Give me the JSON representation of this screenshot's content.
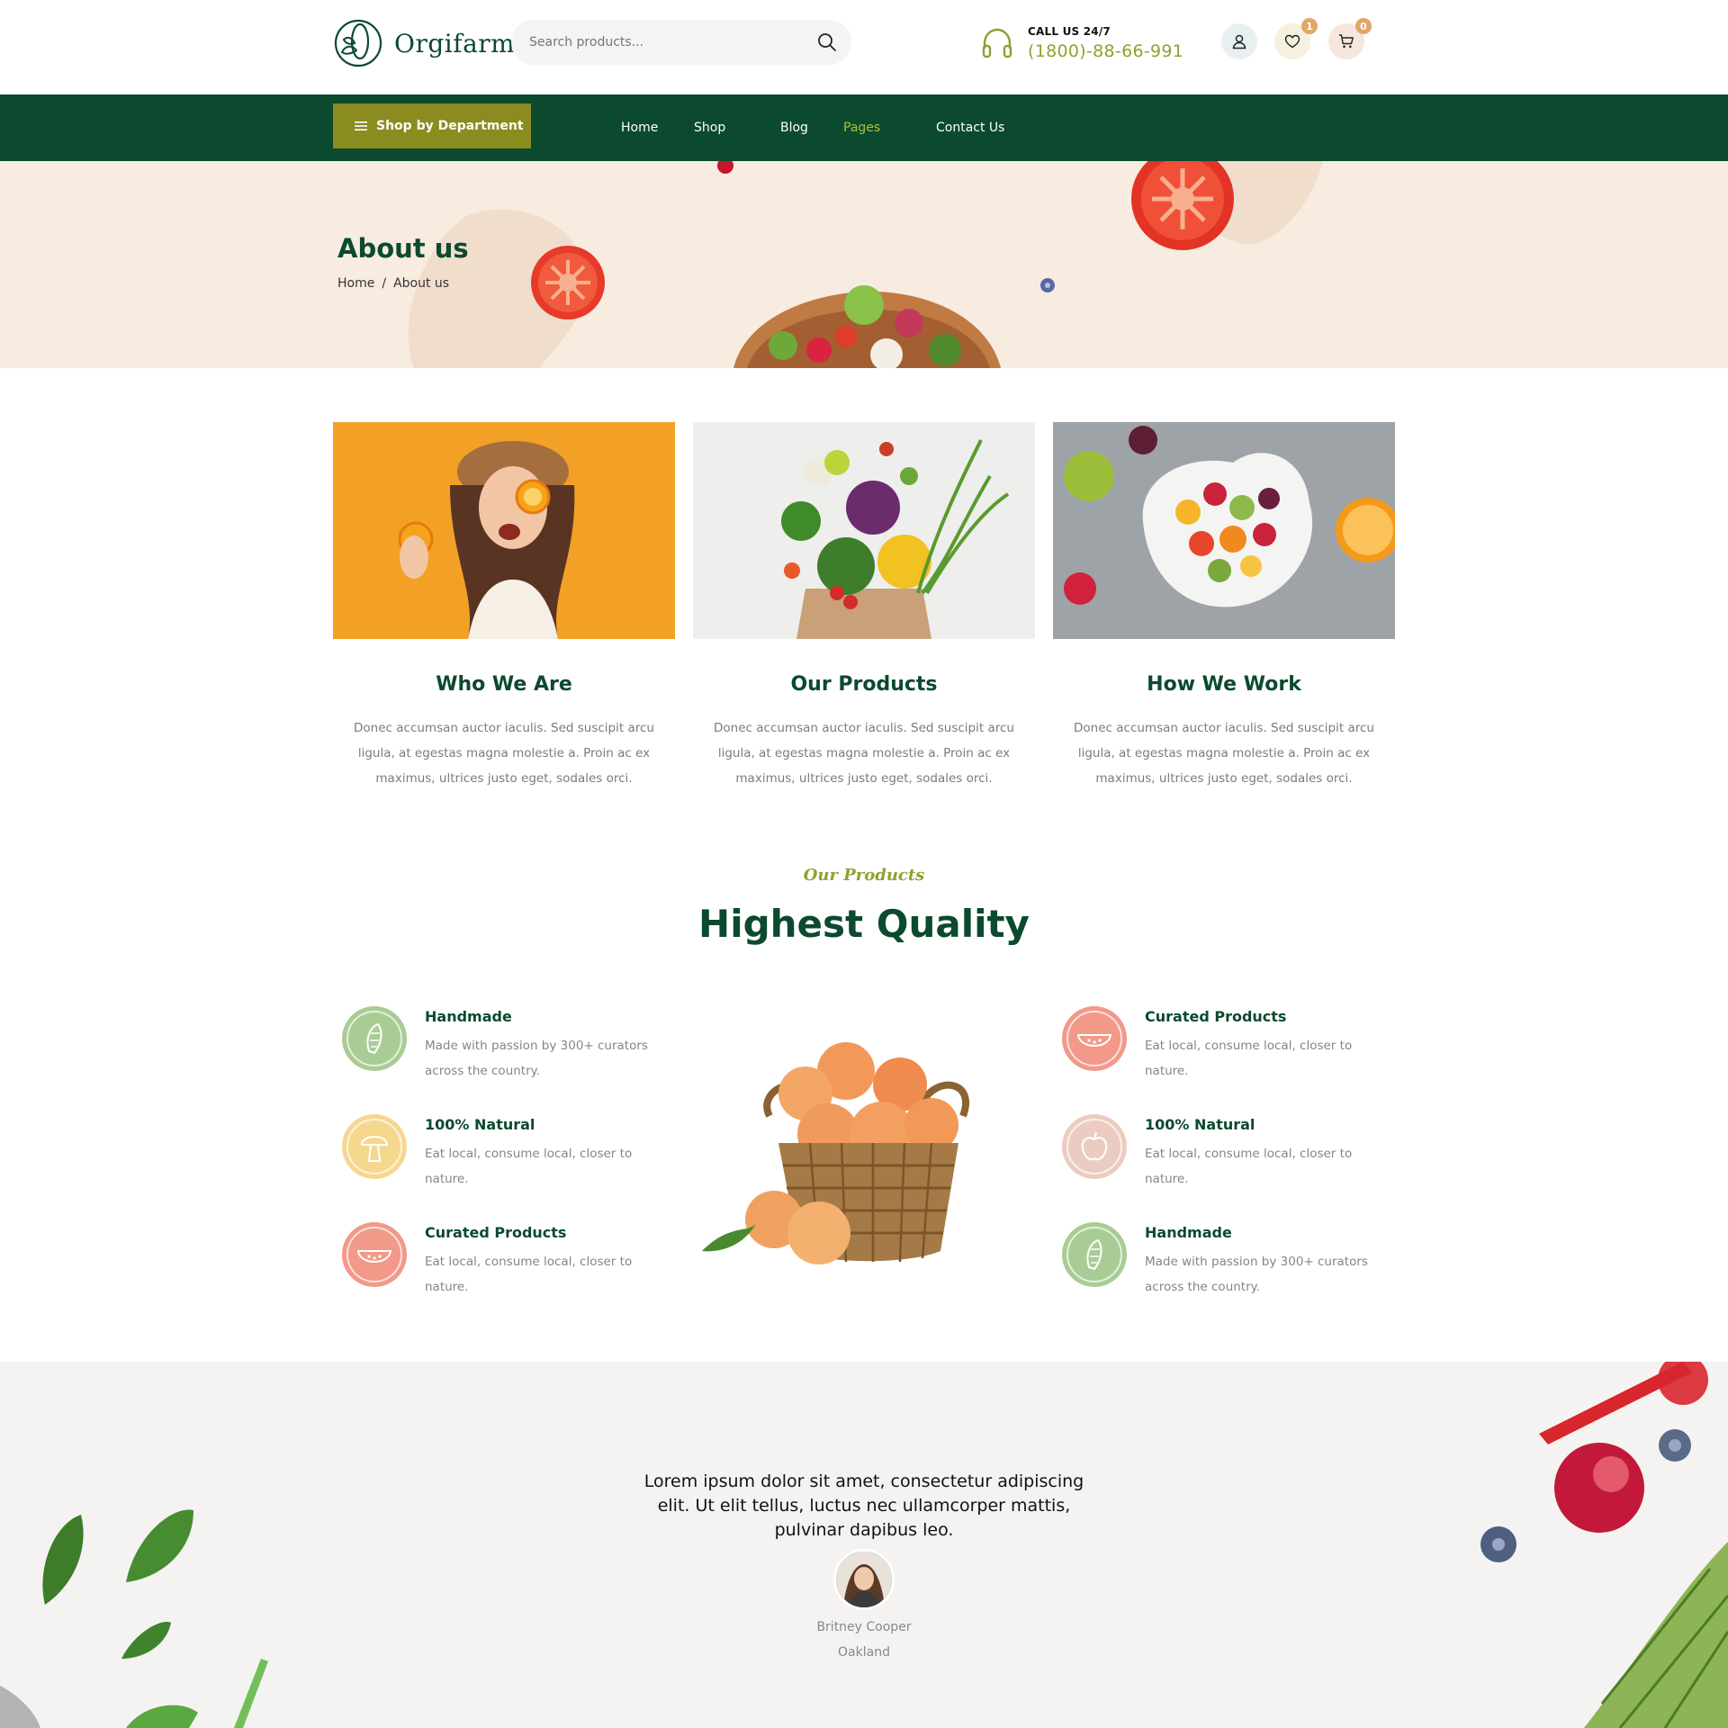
{
  "brand": {
    "name": "Orgifarm"
  },
  "search": {
    "placeholder": "Search products..."
  },
  "contact": {
    "label": "CALL US 24/7",
    "phone": "(1800)-88-66-991"
  },
  "header_icons": {
    "wishlist_count": "1",
    "cart_count": "0"
  },
  "nav": {
    "department_label": "Shop by Department",
    "items": [
      {
        "label": "Home"
      },
      {
        "label": "Shop"
      },
      {
        "label": "Blog"
      },
      {
        "label": "Pages",
        "active": true
      },
      {
        "label": "Contact Us"
      }
    ]
  },
  "hero": {
    "title": "About us",
    "breadcrumb": [
      "Home",
      "About us"
    ]
  },
  "cards": [
    {
      "title": "Who We Are",
      "text": "Donec accumsan auctor iaculis. Sed suscipit arcu ligula, at egestas magna molestie a. Proin ac ex maximus, ultrices justo eget, sodales orci."
    },
    {
      "title": "Our Products",
      "text": "Donec accumsan auctor iaculis. Sed suscipit arcu ligula, at egestas magna molestie a. Proin ac ex maximus, ultrices justo eget, sodales orci."
    },
    {
      "title": "How We Work",
      "text": "Donec accumsan auctor iaculis. Sed suscipit arcu ligula, at egestas magna molestie a. Proin ac ex maximus, ultrices justo eget, sodales orci."
    }
  ],
  "quality": {
    "eyebrow": "Our Products",
    "title": "Highest Quality",
    "left": [
      {
        "title": "Handmade",
        "text": "Made with passion by 300+ curators across the country.",
        "icon": "corn-icon",
        "color": "#a9cc94"
      },
      {
        "title": "100% Natural",
        "text": "Eat local, consume local, closer to nature.",
        "icon": "mushroom-icon",
        "color": "#f6d78e"
      },
      {
        "title": "Curated Products",
        "text": "Eat local, consume local, closer to nature.",
        "icon": "watermelon-icon",
        "color": "#f2998a"
      }
    ],
    "right": [
      {
        "title": "Curated Products",
        "text": "Eat local, consume local, closer to nature.",
        "icon": "watermelon-icon",
        "color": "#f2998a"
      },
      {
        "title": "100% Natural",
        "text": "Eat local, consume local, closer to nature.",
        "icon": "apple-icon",
        "color": "#ecccc0"
      },
      {
        "title": "Handmade",
        "text": "Made with passion by 300+ curators across the country.",
        "icon": "corn-icon",
        "color": "#a9cc94"
      }
    ]
  },
  "testimonial": {
    "quote": "Lorem ipsum dolor sit amet, consectetur adipiscing elit. Ut elit tellus, luctus nec ullamcorper mattis, pulvinar dapibus leo.",
    "name": "Britney Cooper",
    "city": "Oakland"
  },
  "colors": {
    "primary": "#0b4a2e",
    "accent": "#8ea22d",
    "department_button": "#8a8c1f",
    "hero_bg": "#f8ebe0"
  }
}
